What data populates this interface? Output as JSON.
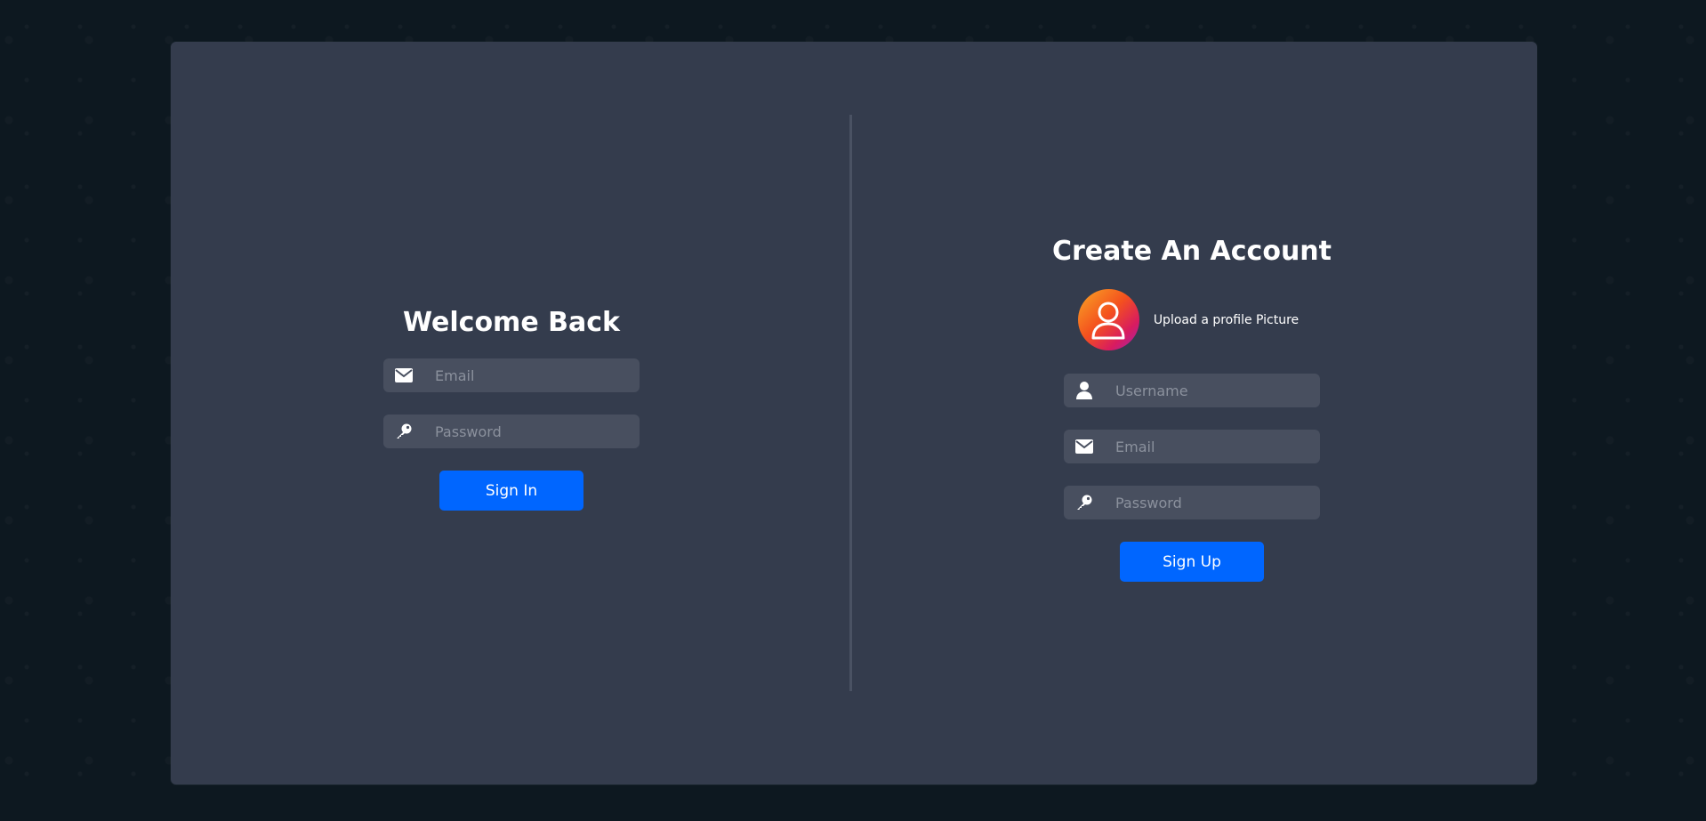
{
  "signin": {
    "title": "Welcome Back",
    "email_placeholder": "Email",
    "password_placeholder": "Password",
    "button_label": "Sign In"
  },
  "signup": {
    "title": "Create An Account",
    "upload_label": "Upload a profile Picture",
    "username_placeholder": "Username",
    "email_placeholder": "Email",
    "password_placeholder": "Password",
    "button_label": "Sign Up"
  },
  "icons": {
    "email": "envelope-icon",
    "password": "key-icon",
    "username": "user-icon",
    "avatar": "user-outline-icon"
  },
  "colors": {
    "accent": "#0066ff",
    "card": "#343c4d",
    "field": "#484f5f",
    "page_bg": "#0d1820"
  }
}
